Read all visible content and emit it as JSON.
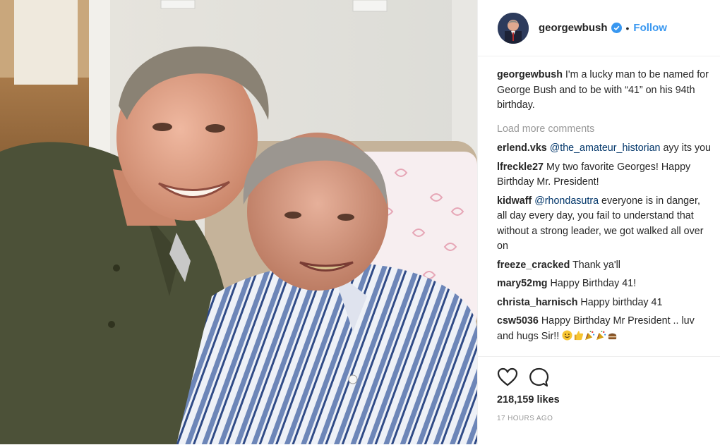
{
  "post": {
    "username": "georgewbush",
    "separator": "•",
    "follow_label": "Follow",
    "icons": {
      "verified": "verified-badge-icon",
      "like": "heart-icon",
      "comment": "comment-bubble-icon"
    },
    "accent_color": "#3897f0"
  },
  "caption": {
    "username": "georgewbush",
    "text": "I'm a lucky man to be named for George Bush and to be with “41” on his 94th birthday."
  },
  "load_more_label": "Load more comments",
  "comments": [
    {
      "username": "erlend.vks",
      "mention": "@the_amateur_historian",
      "text": " ayy its you"
    },
    {
      "username": "lfreckle27",
      "text": "My two favorite Georges! Happy Birthday Mr. President!"
    },
    {
      "username": "kidwaff",
      "mention": "@rhondasutra",
      "text": " everyone is in danger, all day every day, you fail to understand that without a strong leader, we got walked all over on"
    },
    {
      "username": "freeze_cracked",
      "text": "Thank ya'll"
    },
    {
      "username": "mary52mg",
      "text": "Happy Birthday 41!"
    },
    {
      "username": "christa_harnisch",
      "text": "Happy birthday 41"
    },
    {
      "username": "csw5036",
      "text": "Happy Birthday Mr President .. luv and hugs Sir!!",
      "emojis": [
        "smiling-face-emoji",
        "thumbs-up-emoji",
        "party-popper-emoji",
        "party-popper-emoji",
        "cake-emoji"
      ]
    }
  ],
  "likes_text": "218,159 likes",
  "time_text": "17 HOURS AGO"
}
